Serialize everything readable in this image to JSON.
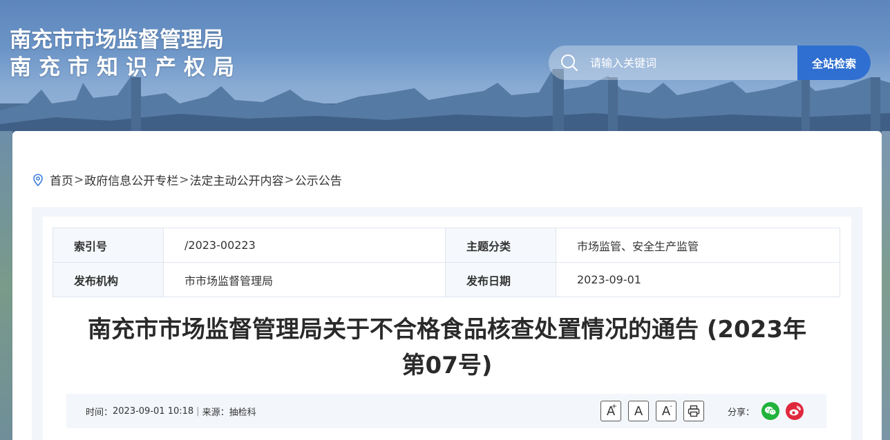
{
  "header": {
    "title_line1": "南充市市场监督管理局",
    "title_line2": "南充市知识产权局",
    "search": {
      "placeholder": "请输入关键词",
      "button_label": "全站检索",
      "icon": "search-icon"
    }
  },
  "breadcrumb": {
    "icon": "location-pin-icon",
    "items": [
      "首页",
      "政府信息公开专栏",
      "法定主动公开内容",
      "公示公告"
    ],
    "separator": ">"
  },
  "meta": {
    "rows": [
      {
        "k1": "索引号",
        "v1": "/2023-00223",
        "k2": "主题分类",
        "v2": "市场监管、安全生产监管"
      },
      {
        "k1": "发布机构",
        "v1": "市市场监督管理局",
        "k2": "发布日期",
        "v2": "2023-09-01"
      }
    ]
  },
  "article": {
    "title_line1": "南充市市场监督管理局关于不合格食品核查处置情况的通告 (2023年",
    "title_line2": "第07号)",
    "time_label": "时间：",
    "time_value": "2023-09-01 10:18",
    "source_label": "来源：",
    "source_value": "抽检科",
    "divider": "|"
  },
  "tools": {
    "font_increase": "A",
    "font_increase_sup": "+",
    "font_default": "A",
    "font_decrease": "A",
    "font_decrease_sup": "-",
    "print_icon": "printer-icon"
  },
  "share": {
    "label": "分享：",
    "icons": [
      "wechat-icon",
      "weibo-icon"
    ]
  },
  "colors": {
    "accent": "#2f6fd1",
    "wechat": "#21b33b",
    "weibo": "#e0283d"
  }
}
